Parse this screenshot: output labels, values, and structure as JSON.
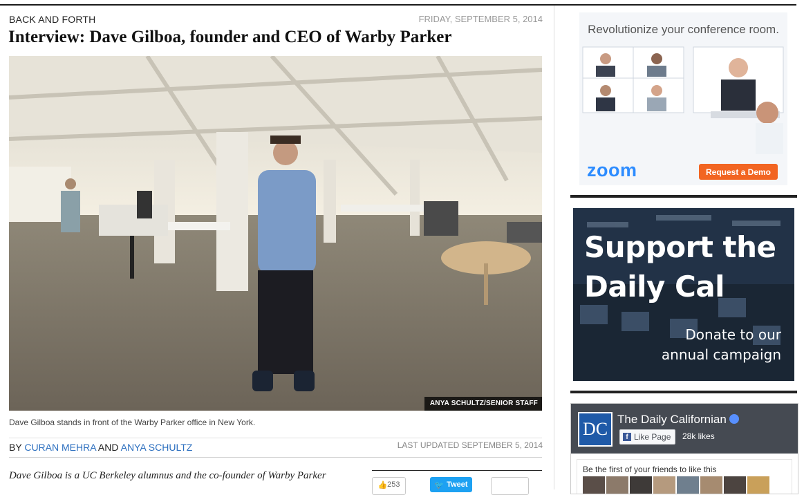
{
  "article": {
    "section": "BACK AND FORTH",
    "date": "FRIDAY, SEPTEMBER 5, 2014",
    "headline": "Interview: Dave Gilboa, founder and CEO of Warby Parker",
    "photo_credit": "ANYA SCHULTZ/SENIOR STAFF",
    "caption": "Dave Gilboa stands in front of the Warby Parker office in New York.",
    "byline_prefix": "BY",
    "author1": "CURAN MEHRA",
    "byline_and": "AND",
    "author2": "ANYA SCHULTZ",
    "updated": "LAST UPDATED SEPTEMBER 5, 2014",
    "lede": "Dave Gilboa is a UC Berkeley alumnus and the co-founder of Warby Parker"
  },
  "share": {
    "like_count": "253",
    "tweet_label": "Tweet"
  },
  "ads": {
    "zoom": {
      "tagline": "Revolutionize your conference room.",
      "logo": "zoom",
      "cta": "Request a Demo"
    },
    "support": {
      "headline_line1": "Support the",
      "headline_line2": "Daily Cal",
      "sub_line1": "Donate to our",
      "sub_line2": "annual campaign"
    }
  },
  "facebook": {
    "logo": "DC",
    "page_name": "The Daily Californian",
    "like_button": "Like Page",
    "likes": "28k likes",
    "friends_text": "Be the first of your friends to like this"
  },
  "colors": {
    "link": "#2c6fbf",
    "zoom_blue": "#2d8cff",
    "cta_orange": "#f26522",
    "twitter": "#1da1f2",
    "facebook": "#3b5998"
  }
}
